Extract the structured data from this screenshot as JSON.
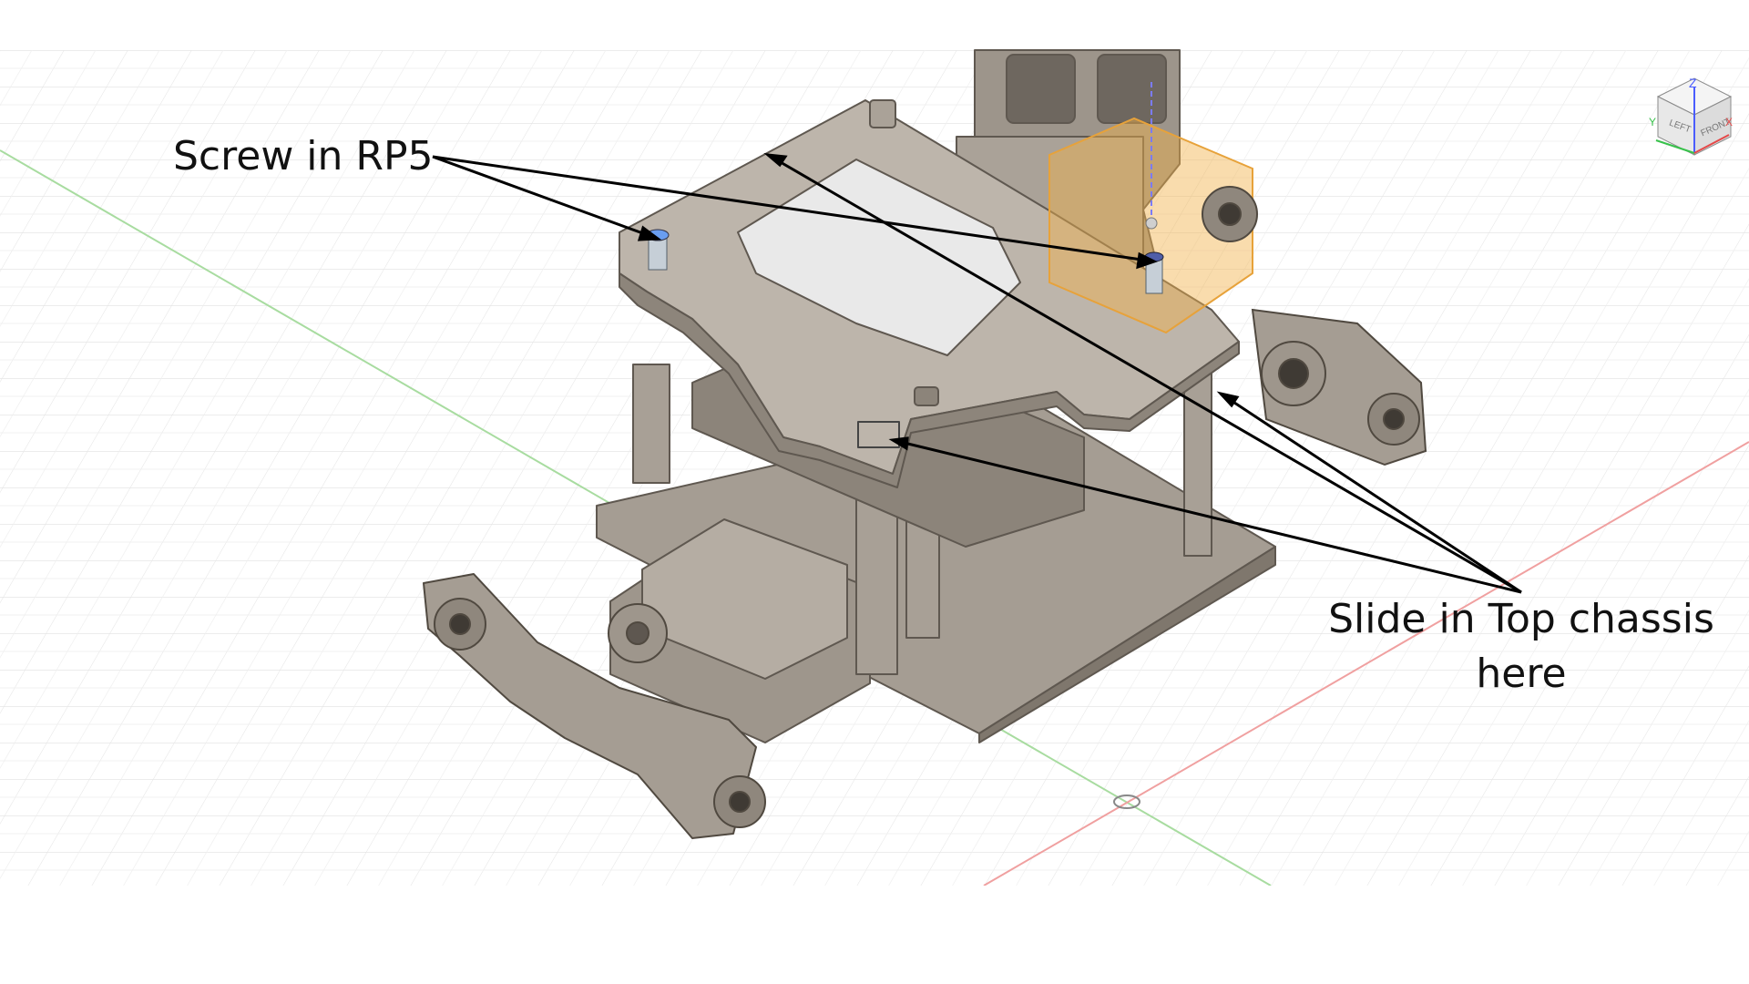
{
  "annotations": {
    "screw_label": "Screw in RP5",
    "slide_label": "Slide in Top chassis here"
  },
  "viewcube": {
    "face_left": "LEFT",
    "face_front": "FRONT",
    "axis_z": "Z",
    "axis_y": "Y",
    "axis_x": "X"
  },
  "colors": {
    "background": "#ffffff",
    "grid": "#e4e4e4",
    "axis_x": "#f0a0a0",
    "axis_y": "#a8dca0",
    "axis_z": "#8080ff",
    "part": "#b5ada3",
    "part_dark": "#7f776d",
    "selection": "#f2b24a"
  }
}
